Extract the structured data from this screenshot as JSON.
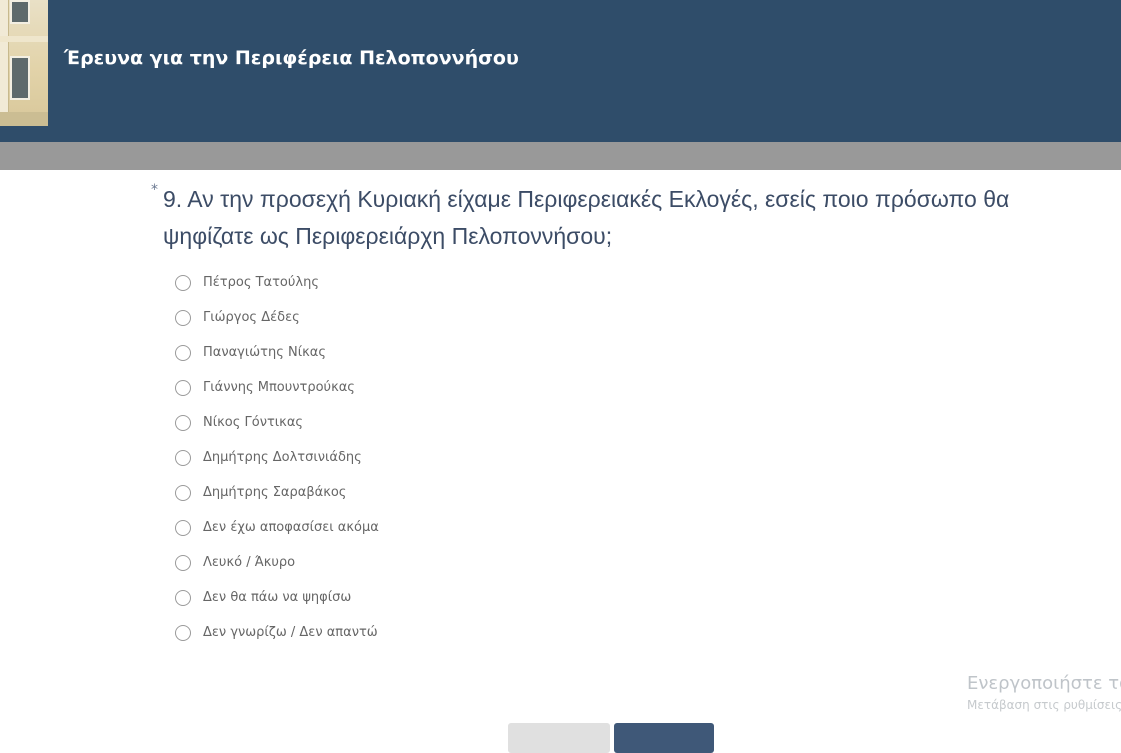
{
  "header": {
    "title": "Έρευνα για την Περιφέρεια Πελοποννήσου",
    "background_color": "#2f4d6a",
    "logo_icon": "building-facade-logo"
  },
  "progress": {
    "track_color": "#999999"
  },
  "question": {
    "required_marker": "*",
    "text": "9. Αν την προσεχή Κυριακή είχαμε Περιφερειακές Εκλογές, εσείς ποιο πρόσωπο θα ψηφίζατε ως Περιφερειάρχη Πελοποννήσου;",
    "options": [
      {
        "label": "Πέτρος Τατούλης",
        "selected": false
      },
      {
        "label": "Γιώργος Δέδες",
        "selected": false
      },
      {
        "label": "Παναγιώτης Νίκας",
        "selected": false
      },
      {
        "label": "Γιάννης Μπουντρούκας",
        "selected": false
      },
      {
        "label": "Νίκος Γόντικας",
        "selected": false
      },
      {
        "label": "Δημήτρης Δολτσινιάδης",
        "selected": false
      },
      {
        "label": "Δημήτρης Σαραβάκος",
        "selected": false
      },
      {
        "label": "Δεν έχω αποφασίσει ακόμα",
        "selected": false
      },
      {
        "label": "Λευκό / Άκυρο",
        "selected": false
      },
      {
        "label": "Δεν θα πάω να ψηφίσω",
        "selected": false
      },
      {
        "label": "Δεν γνωρίζω / Δεν απαντώ",
        "selected": false
      }
    ]
  },
  "watermark": {
    "line1": "Ενεργοποιήστε τα",
    "line2": "Μετάβαση στις ρυθμίσεις"
  },
  "buttons": {
    "prev_color": "#e0e0e0",
    "next_color": "#3f5878"
  }
}
